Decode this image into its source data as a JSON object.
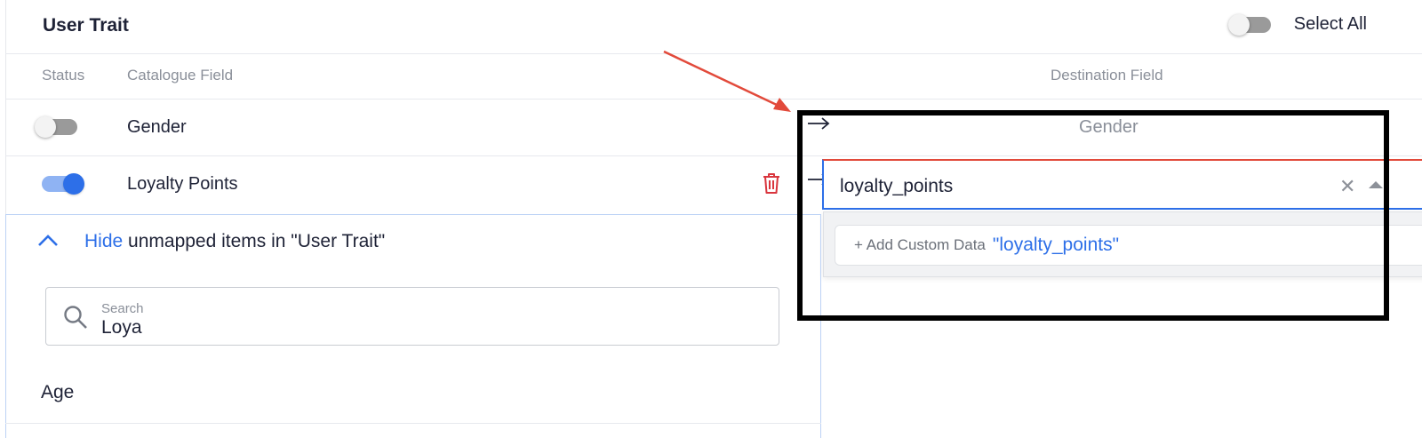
{
  "header": {
    "title": "User Trait",
    "select_all_label": "Select All",
    "select_all_on": false
  },
  "columns": {
    "status": "Status",
    "catalogue_field": "Catalogue Field",
    "destination_field": "Destination Field"
  },
  "rows": [
    {
      "catalogue": "Gender",
      "enabled": false,
      "destination": "Gender"
    },
    {
      "catalogue": "Loyalty Points",
      "enabled": true,
      "destination_input": "loyalty_points"
    }
  ],
  "dropdown": {
    "add_custom_prefix": "+ Add Custom Data",
    "add_custom_value": "\"loyalty_points\""
  },
  "unmapped": {
    "hide_link": "Hide",
    "hide_text": " unmapped items in \"User Trait\"",
    "search_label": "Search",
    "search_value": "Loya",
    "items": [
      "Age"
    ]
  },
  "icons": {
    "trash": "trash-icon",
    "arrow": "arrow-right-icon",
    "clear": "close-icon",
    "caret": "caret-up-icon",
    "chevron": "chevron-up-icon",
    "search": "search-icon"
  },
  "colors": {
    "accent": "#2d6fe8",
    "danger": "#d9363e",
    "annotation_red": "#e24a3b",
    "annotation_box": "#000000"
  }
}
